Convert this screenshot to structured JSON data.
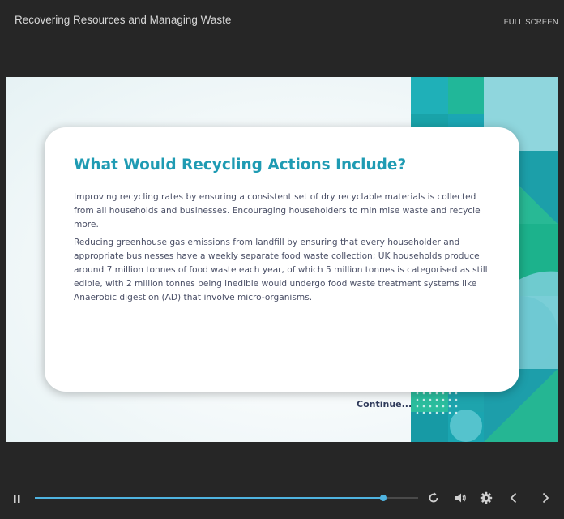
{
  "header": {
    "course_title": "Recovering Resources and Managing Waste",
    "fullscreen_label": "FULL SCREEN"
  },
  "slide": {
    "title": "What Would Recycling Actions Include?",
    "paragraphs": [
      "Improving recycling rates by ensuring a consistent set of dry recyclable materials is collected from all households and businesses. Encouraging householders to minimise waste and recycle more.",
      "Reducing greenhouse gas emissions from landfill by ensuring that every householder and appropriate businesses have a weekly separate food waste collection; UK households produce around 7 million tonnes of food waste each year, of which 5 million tonnes is categorised as still edible, with 2 million tonnes being inedible would undergo food waste treatment systems like Anaerobic digestion (AD) that involve micro-organisms."
    ],
    "continue_label": "Continue..."
  },
  "player": {
    "progress": 0.91,
    "accent_color": "#4fb3e0",
    "controls": [
      "pause-icon",
      "replay-icon",
      "volume-icon",
      "settings-icon",
      "previous-icon",
      "next-icon"
    ]
  },
  "colors": {
    "title": "#1f9bb3",
    "teal_dark": "#17a3a6",
    "teal_light": "#7fd1db",
    "green": "#1db38f"
  }
}
